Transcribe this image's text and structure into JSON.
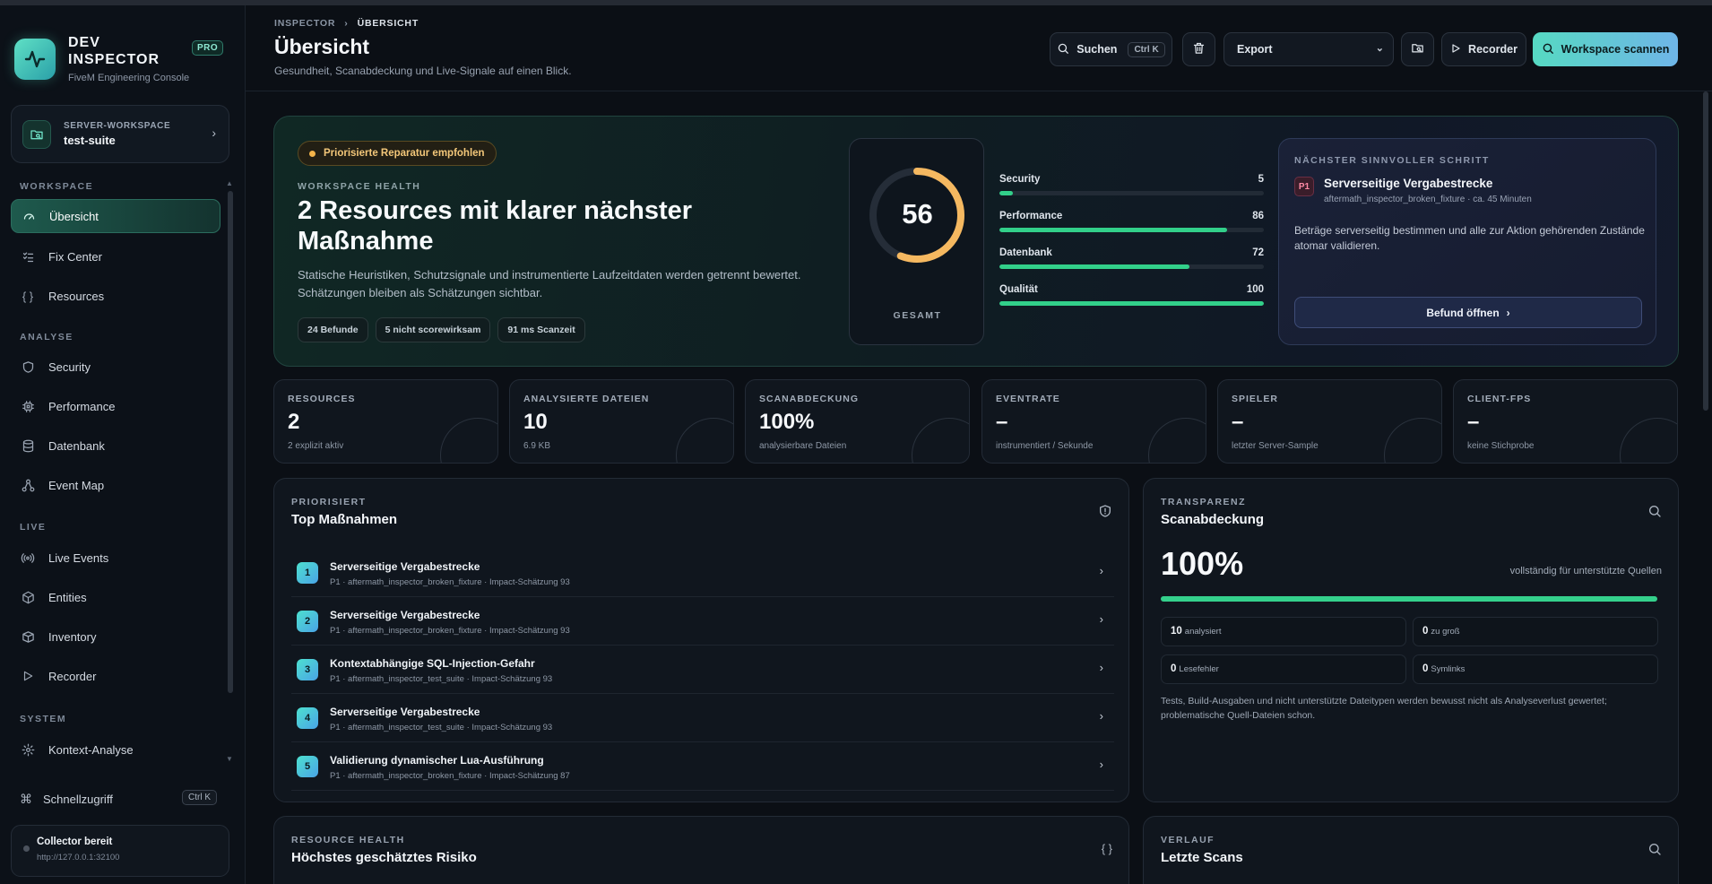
{
  "brand": {
    "name": "DEV INSPECTOR",
    "subtitle": "FiveM Engineering Console",
    "badge": "PRO"
  },
  "workspace": {
    "label": "SERVER-WORKSPACE",
    "value": "test-suite"
  },
  "nav": {
    "sections": [
      "WORKSPACE",
      "ANALYSE",
      "LIVE",
      "SYSTEM"
    ],
    "items": [
      {
        "label": "Übersicht",
        "icon": "gauge-icon"
      },
      {
        "label": "Fix Center",
        "icon": "checklist-icon"
      },
      {
        "label": "Resources",
        "icon": "braces-icon"
      },
      {
        "label": "Security",
        "icon": "shield-icon"
      },
      {
        "label": "Performance",
        "icon": "cpu-icon"
      },
      {
        "label": "Datenbank",
        "icon": "database-icon"
      },
      {
        "label": "Event Map",
        "icon": "network-icon"
      },
      {
        "label": "Live Events",
        "icon": "radio-icon"
      },
      {
        "label": "Entities",
        "icon": "cube-icon"
      },
      {
        "label": "Inventory",
        "icon": "box-icon"
      },
      {
        "label": "Recorder",
        "icon": "play-icon"
      },
      {
        "label": "Kontext-Analyse",
        "icon": "sparkle-icon"
      }
    ]
  },
  "quick_access": {
    "label": "Schnellzugriff",
    "shortcut": "Ctrl K"
  },
  "collector": {
    "title": "Collector bereit",
    "url": "http://127.0.0.1:32100"
  },
  "header": {
    "breadcrumb": [
      "INSPECTOR",
      "ÜBERSICHT"
    ],
    "title": "Übersicht",
    "subtitle": "Gesundheit, Scanabdeckung und Live-Signale auf einen Blick.",
    "search_label": "Suchen",
    "search_shortcut": "Ctrl K",
    "export_selected": "Export",
    "recorder_label": "Recorder",
    "scan_label": "Workspace scannen"
  },
  "hero": {
    "badge": "Priorisierte Reparatur empfohlen",
    "eyebrow": "WORKSPACE HEALTH",
    "title": "2 Resources mit klarer nächster Maßnahme",
    "description": "Statische Heuristiken, Schutzsignale und instrumentierte Laufzeitdaten werden getrennt bewertet. Schätzungen bleiben als Schätzungen sichtbar.",
    "chips": [
      "24 Befunde",
      "5 nicht scorewirksam",
      "91 ms Scanzeit"
    ],
    "score": {
      "value": "56",
      "label": "GESAMT",
      "fraction": 0.56
    },
    "metrics": [
      {
        "label": "Security",
        "value": "5",
        "percent": 5
      },
      {
        "label": "Performance",
        "value": "86",
        "percent": 86
      },
      {
        "label": "Datenbank",
        "value": "72",
        "percent": 72
      },
      {
        "label": "Qualität",
        "value": "100",
        "percent": 100
      }
    ],
    "next_step": {
      "eyebrow": "NÄCHSTER SINNVOLLER SCHRITT",
      "priority": "P1",
      "title": "Serverseitige Vergabestrecke",
      "meta": "aftermath_inspector_broken_fixture · ca. 45 Minuten",
      "description": "Beträge serverseitig bestimmen und alle zur Aktion gehörenden Zustände atomar validieren.",
      "button": "Befund öffnen"
    }
  },
  "stats": [
    {
      "label": "RESOURCES",
      "value": "2",
      "sub": "2 explizit aktiv"
    },
    {
      "label": "ANALYSIERTE DATEIEN",
      "value": "10",
      "sub": "6.9 KB"
    },
    {
      "label": "SCANABDECKUNG",
      "value": "100%",
      "sub": "analysierbare Dateien"
    },
    {
      "label": "EVENTRATE",
      "value": "–",
      "sub": "instrumentiert / Sekunde"
    },
    {
      "label": "SPIELER",
      "value": "–",
      "sub": "letzter Server-Sample"
    },
    {
      "label": "CLIENT-FPS",
      "value": "–",
      "sub": "keine Stichprobe"
    }
  ],
  "top_actions": {
    "eyebrow": "PRIORISIERT",
    "title": "Top Maßnahmen",
    "items": [
      {
        "num": "1",
        "title": "Serverseitige Vergabestrecke",
        "meta": "P1 · aftermath_inspector_broken_fixture · Impact-Schätzung 93"
      },
      {
        "num": "2",
        "title": "Serverseitige Vergabestrecke",
        "meta": "P1 · aftermath_inspector_broken_fixture · Impact-Schätzung 93"
      },
      {
        "num": "3",
        "title": "Kontextabhängige SQL-Injection-Gefahr",
        "meta": "P1 · aftermath_inspector_test_suite · Impact-Schätzung 93"
      },
      {
        "num": "4",
        "title": "Serverseitige Vergabestrecke",
        "meta": "P1 · aftermath_inspector_test_suite · Impact-Schätzung 93"
      },
      {
        "num": "5",
        "title": "Validierung dynamischer Lua-Ausführung",
        "meta": "P1 · aftermath_inspector_broken_fixture · Impact-Schätzung 87"
      }
    ]
  },
  "coverage": {
    "eyebrow": "TRANSPARENZ",
    "title": "Scanabdeckung",
    "percent": "100%",
    "percent_value": 100,
    "note": "vollständig für unterstützte Quellen",
    "cells": [
      {
        "value": "10",
        "label": "analysiert"
      },
      {
        "value": "0",
        "label": "zu groß"
      },
      {
        "value": "0",
        "label": "Lesefehler"
      },
      {
        "value": "0",
        "label": "Symlinks"
      }
    ],
    "footer": "Tests, Build-Ausgaben und nicht unterstützte Dateitypen werden bewusst nicht als Analyseverlust gewertet; problematische Quell-Dateien schon."
  },
  "resource_health": {
    "eyebrow": "RESOURCE HEALTH",
    "title": "Höchstes geschätztes Risiko"
  },
  "history": {
    "eyebrow": "VERLAUF",
    "title": "Letzte Scans"
  },
  "colors": {
    "accent": "#56d9c2",
    "success": "#32d08a",
    "warning": "#f3b44a",
    "score": "#f5b860",
    "background": "#0b0f15"
  }
}
